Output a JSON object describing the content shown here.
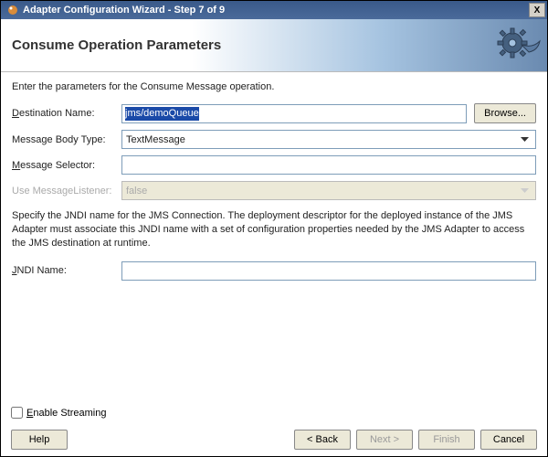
{
  "window": {
    "title": "Adapter Configuration Wizard - Step 7 of 9"
  },
  "header": {
    "title": "Consume Operation Parameters"
  },
  "intro": "Enter the parameters for the Consume Message operation.",
  "labels": {
    "destination_pre": "D",
    "destination_post": "estination Name:",
    "msgbody": "Message Body Type:",
    "selector_pre": "M",
    "selector_post": "essage Selector:",
    "useml": "Use MessageListener:",
    "jndi_pre": "J",
    "jndi_post": "NDI Name:",
    "streaming_pre": "E",
    "streaming_post": "nable Streaming"
  },
  "fields": {
    "destination": "jms/demoQueue",
    "msgbody": "TextMessage",
    "selector": "",
    "useml": "false",
    "jndi": ""
  },
  "buttons": {
    "browse": "Browse...",
    "help": "Help",
    "back": "< Back",
    "next": "Next >",
    "finish": "Finish",
    "cancel": "Cancel"
  },
  "desc": "Specify the JNDI name for the JMS Connection.  The deployment descriptor for the deployed instance of the JMS Adapter must associate this JNDI name with a set of configuration properties needed by the JMS Adapter to access the JMS destination at runtime.",
  "icons": {
    "close": "X"
  }
}
